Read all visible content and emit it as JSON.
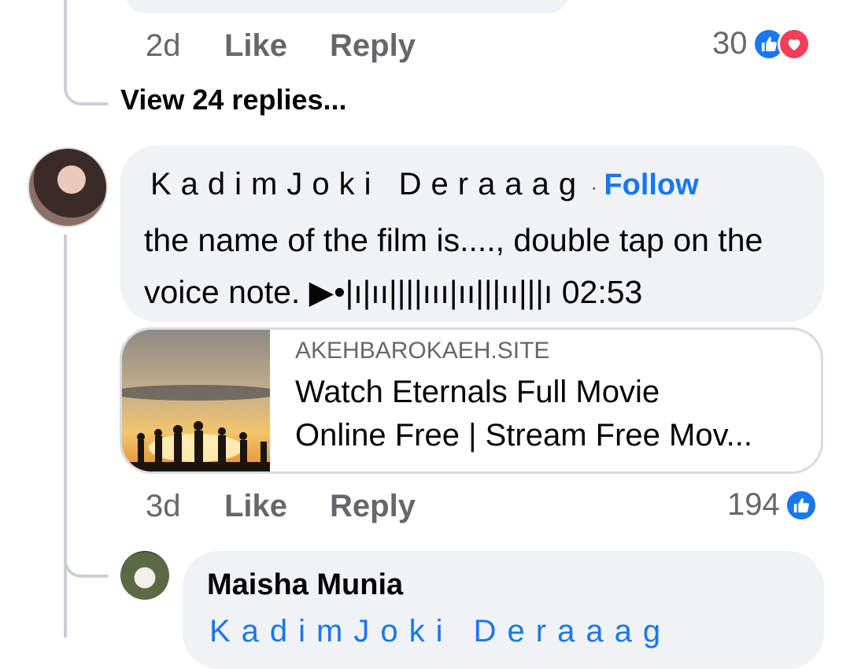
{
  "previous_comment": {
    "time": "2d",
    "like_label": "Like",
    "reply_label": "Reply",
    "reaction_count": "30",
    "reactions": [
      "like-icon",
      "love-icon"
    ]
  },
  "view_replies": "View 24 replies...",
  "comment": {
    "author": "KadimJoki Deraaag",
    "follow_label": "Follow",
    "text": "the name of the film is...., double tap on the voice note. ▶•|ı|ıı||||ııı|ıı|||ıı|||ı 02:53",
    "link": {
      "domain": "AKEHBAROKAEH.SITE",
      "title_line1": "Watch Eternals Full Movie",
      "title_line2": "Online Free | Stream Free Mov..."
    },
    "time": "3d",
    "like_label": "Like",
    "reply_label": "Reply",
    "reaction_count": "194",
    "reactions": [
      "like-icon"
    ]
  },
  "reply": {
    "author": "Maisha Munia",
    "tag": "KadimJoki Deraaag"
  },
  "colors": {
    "accent": "#1877f2",
    "love": "#f33e58",
    "bubble": "#f0f2f5",
    "muted": "#65676b"
  }
}
